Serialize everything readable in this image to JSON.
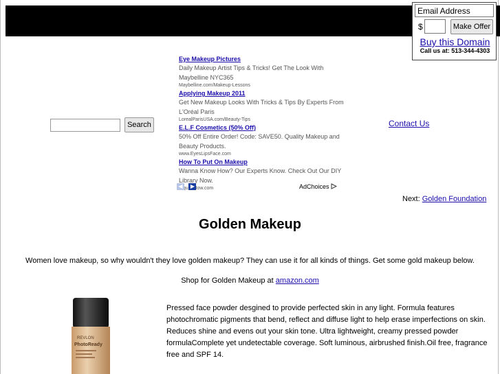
{
  "offer": {
    "email_placeholder": "Email Address",
    "currency_symbol": "$",
    "button_label": "Make Offer",
    "buy_link": "Buy this Domain",
    "call_us": "Call us at: 513-344-4303"
  },
  "search": {
    "button_label": "Search"
  },
  "ads": [
    {
      "title": "Eye Makeup Pictures",
      "description": "Daily Makeup Artist Tips & Tricks! Get The Look With Maybelline NYC365",
      "url": "Maybelline.com/Makeup-Lessons"
    },
    {
      "title": "Applying Makeup 2011",
      "description": "Get New Makeup Looks With Tricks & Tips By Experts From L'Oréal Paris",
      "url": "LorealParisUSA.com/Beauty-Tips"
    },
    {
      "title": "E.L.F Cosmetics (50% Off)",
      "description": "50% Off Entire Order! Code: SAVE50. Quality Makeup and Beauty Products.",
      "url": "www.EyesLipsFace.com"
    },
    {
      "title": "How To Put On Makeup",
      "description": "Wanna Know How? Our Experts Know. Check Out Our DIY Library Now.",
      "url": "InquireHow.com"
    }
  ],
  "ad_nav": {
    "prev_icon": "chevron-left-icon",
    "next_icon": "chevron-right-icon",
    "adchoices_label": "AdChoices",
    "adchoices_icon": "adchoices-triangle-icon"
  },
  "contact_link": "Contact Us",
  "next": {
    "prefix": "Next:",
    "link": "Golden Foundation"
  },
  "page_title": "Golden Makeup",
  "intro": "Women love makeup, so why wouldn't they love golden makeup? They can use it for all kinds of things. Get some gold makeup below.",
  "shop": {
    "prefix": "Shop for Golden Makeup at",
    "link": "amazon.com"
  },
  "product": {
    "brand_label": "REVLON",
    "product_label": "PhotoReady",
    "description": "Pressed face powder desgined to provide perfected skin in any light. Formula features photochromatic pigments that bend, reflect and diffuse light to help erase imperfections on skin. Reduces shine and evens out your skin tone. Ultra lightweight, creamy pressed powder formulaComplete yet undetectable coverage. Soft luminous, airbrushed finish.Oil free, fragrance free and SPF 14."
  },
  "colors": {
    "link": "#1a0dab",
    "header_bar": "#000000",
    "ad_text": "#555555"
  }
}
